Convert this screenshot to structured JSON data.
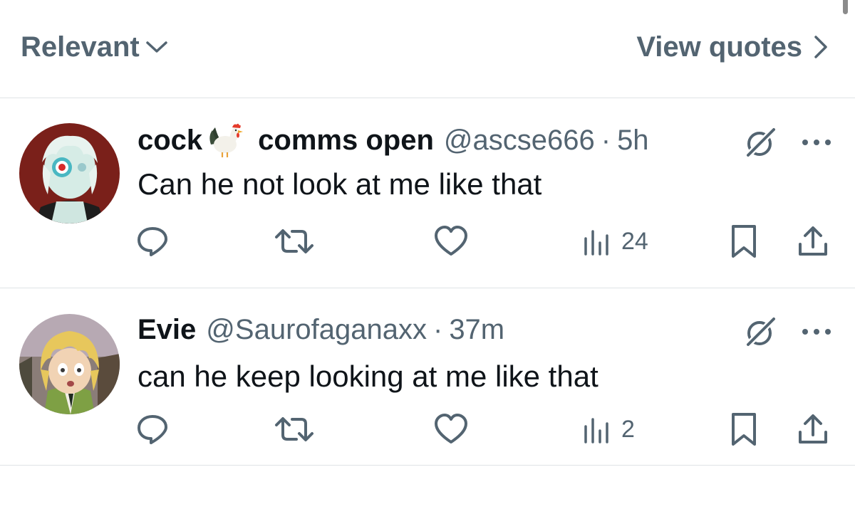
{
  "header": {
    "sort_label": "Relevant",
    "quotes_label": "View quotes"
  },
  "replies": [
    {
      "display_name": "cock",
      "name_emoji": "rooster",
      "name_extra": "comms open",
      "handle": "@ascse666",
      "separator": "·",
      "time": "5h",
      "text": "Can he not look at me like that",
      "views": "24"
    },
    {
      "display_name": "Evie",
      "handle": "@Saurofaganaxx",
      "separator": "·",
      "time": "37m",
      "text": "can he keep looking at me like that",
      "views": "2"
    }
  ],
  "icons": {
    "sort": "chevron-down-icon",
    "quotes": "chevron-right-icon",
    "grok": "grok-icon",
    "more": "more-icon",
    "reply": "reply-icon",
    "retweet": "retweet-icon",
    "like": "heart-icon",
    "views": "views-icon",
    "bookmark": "bookmark-icon",
    "share": "share-icon"
  },
  "colors": {
    "text_primary": "#0f1419",
    "text_secondary": "#536471",
    "divider": "#dfe3e6"
  }
}
